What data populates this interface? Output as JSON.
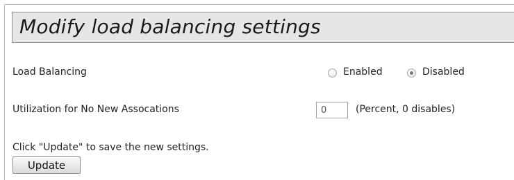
{
  "title": "Modify load balancing settings",
  "load_balancing": {
    "label": "Load Balancing",
    "options": [
      {
        "label": "Enabled",
        "selected": false
      },
      {
        "label": "Disabled",
        "selected": true
      }
    ]
  },
  "utilization": {
    "label": "Utilization for No New Assocations",
    "value": "0",
    "hint": "(Percent, 0 disables)"
  },
  "instructions": "Click \"Update\" to save the new settings.",
  "update_button": "Update"
}
